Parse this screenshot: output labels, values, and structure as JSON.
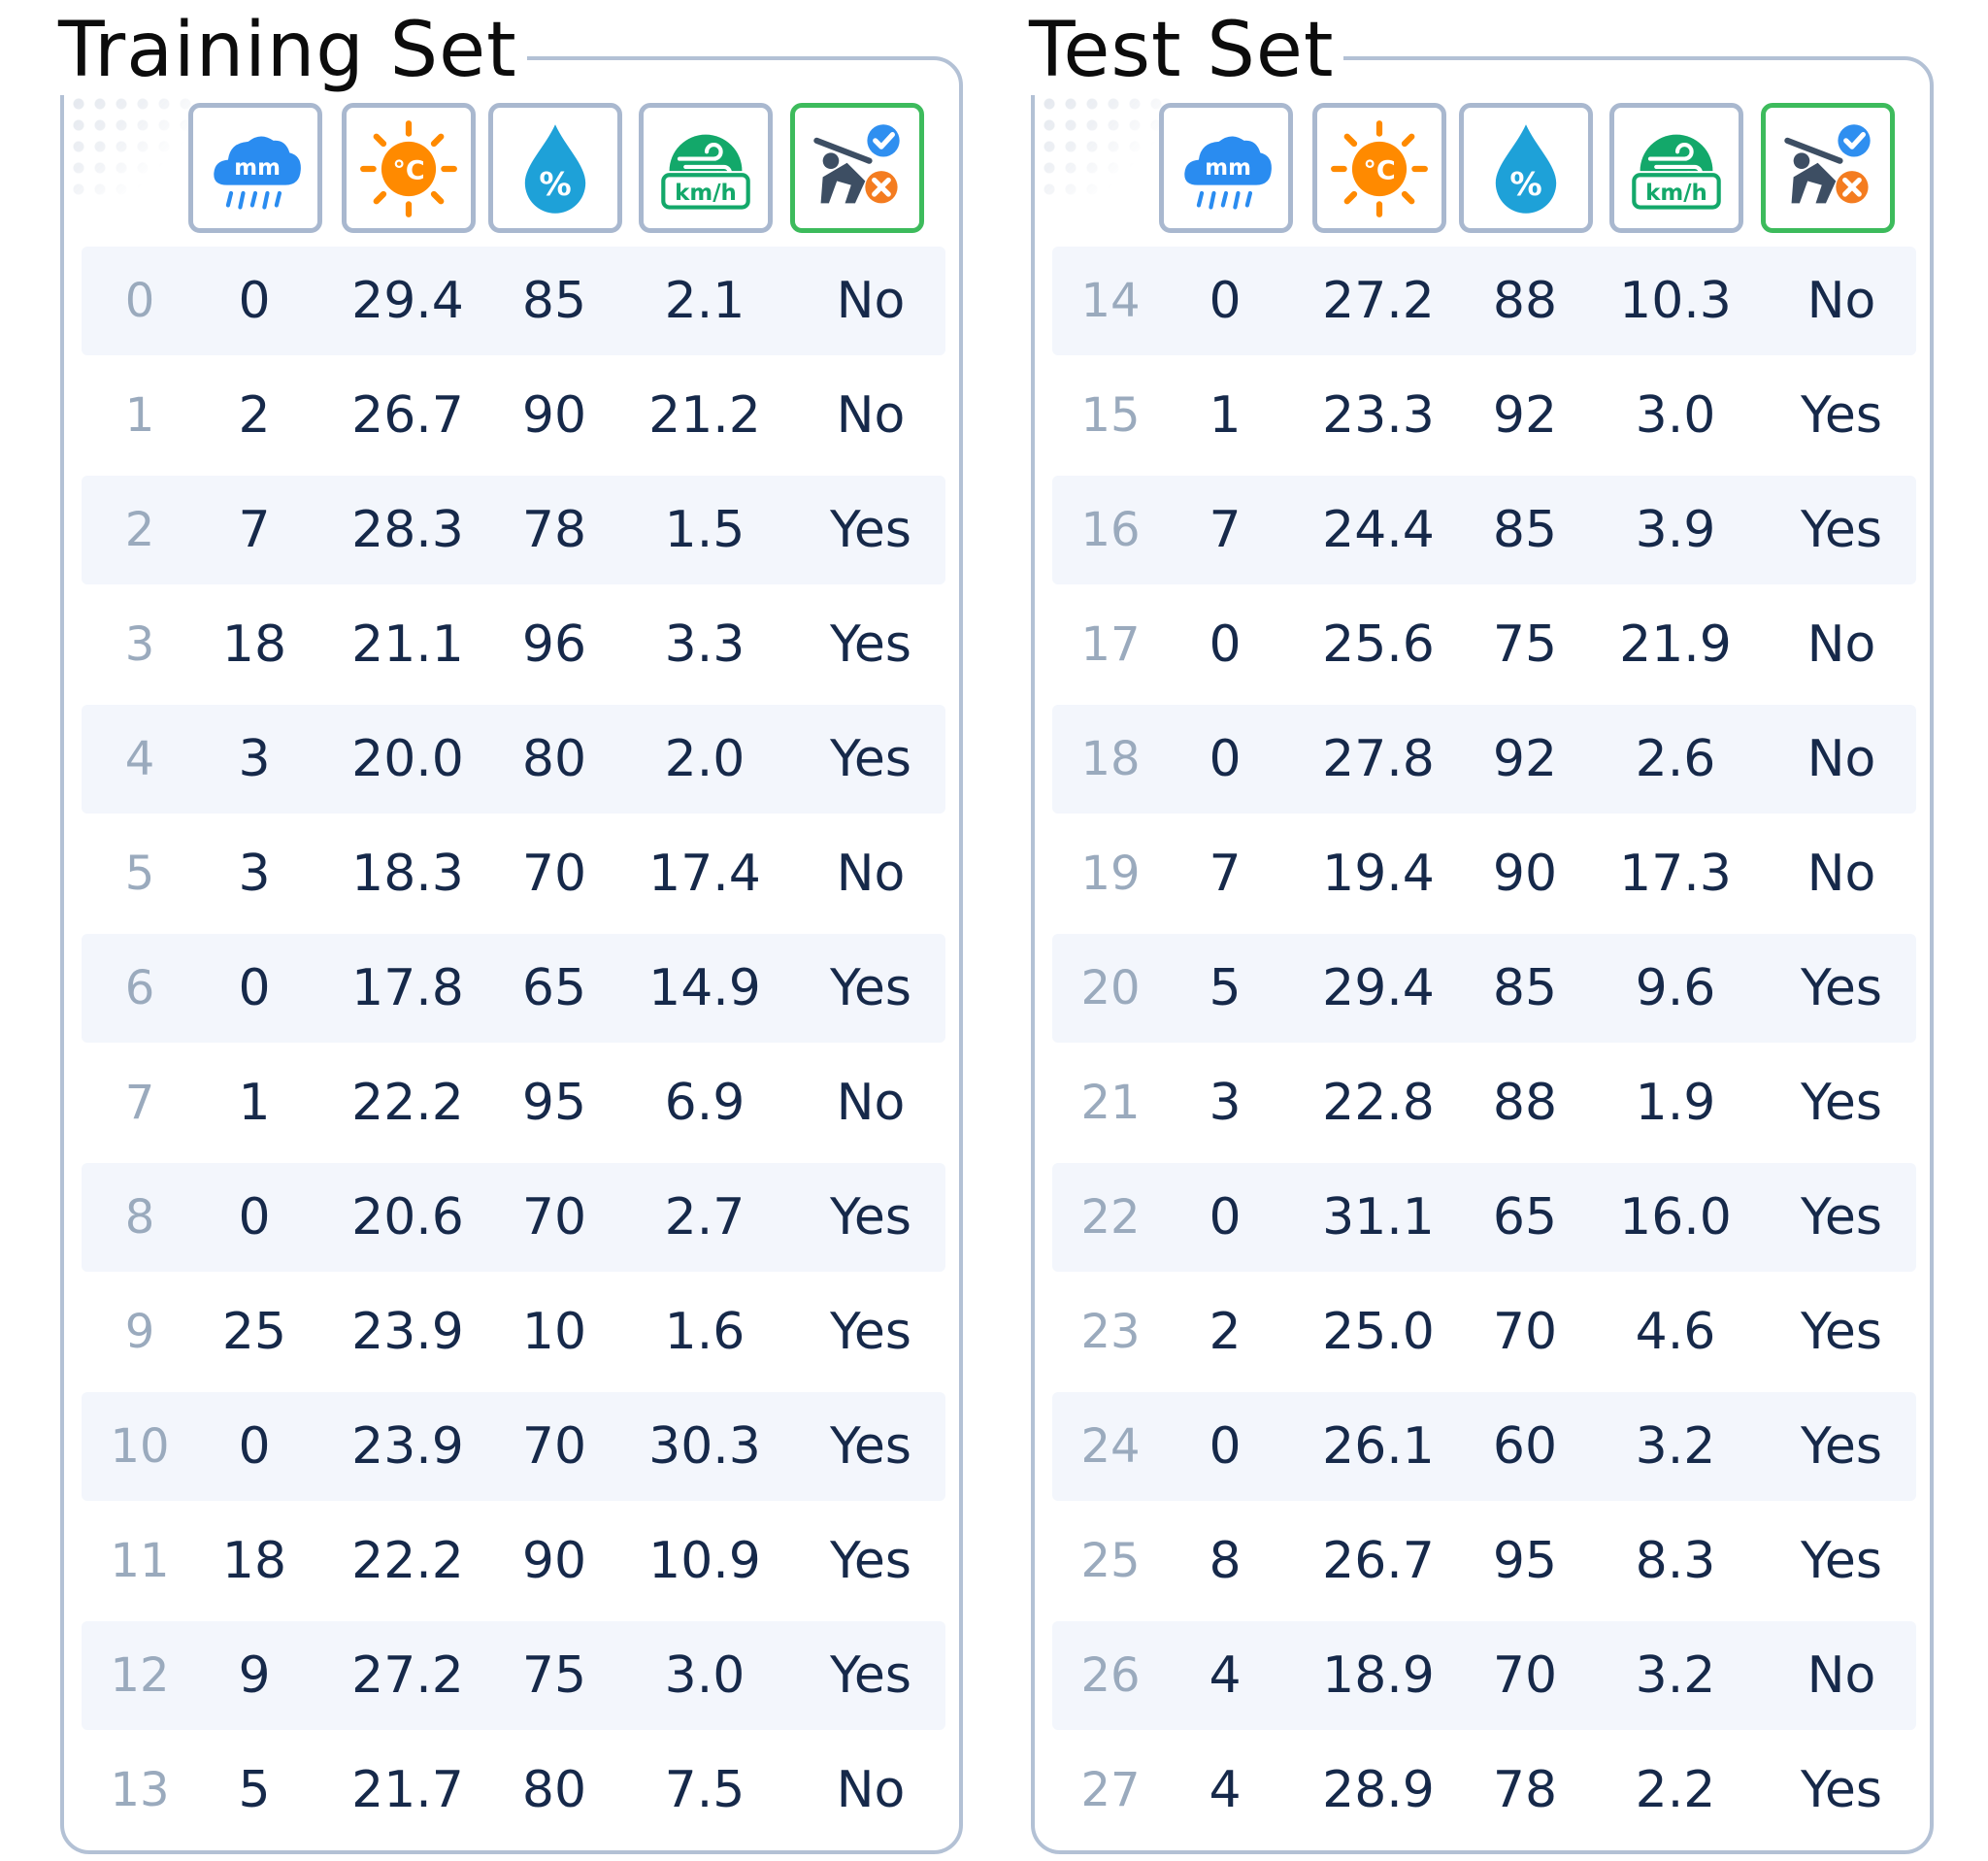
{
  "panels": [
    {
      "title": "Training Set",
      "rows": [
        {
          "index": "0",
          "rain_mm": "0",
          "temp_c": "29.4",
          "humidity_pct": "85",
          "wind_kmh": "2.1",
          "label": "No"
        },
        {
          "index": "1",
          "rain_mm": "2",
          "temp_c": "26.7",
          "humidity_pct": "90",
          "wind_kmh": "21.2",
          "label": "No"
        },
        {
          "index": "2",
          "rain_mm": "7",
          "temp_c": "28.3",
          "humidity_pct": "78",
          "wind_kmh": "1.5",
          "label": "Yes"
        },
        {
          "index": "3",
          "rain_mm": "18",
          "temp_c": "21.1",
          "humidity_pct": "96",
          "wind_kmh": "3.3",
          "label": "Yes"
        },
        {
          "index": "4",
          "rain_mm": "3",
          "temp_c": "20.0",
          "humidity_pct": "80",
          "wind_kmh": "2.0",
          "label": "Yes"
        },
        {
          "index": "5",
          "rain_mm": "3",
          "temp_c": "18.3",
          "humidity_pct": "70",
          "wind_kmh": "17.4",
          "label": "No"
        },
        {
          "index": "6",
          "rain_mm": "0",
          "temp_c": "17.8",
          "humidity_pct": "65",
          "wind_kmh": "14.9",
          "label": "Yes"
        },
        {
          "index": "7",
          "rain_mm": "1",
          "temp_c": "22.2",
          "humidity_pct": "95",
          "wind_kmh": "6.9",
          "label": "No"
        },
        {
          "index": "8",
          "rain_mm": "0",
          "temp_c": "20.6",
          "humidity_pct": "70",
          "wind_kmh": "2.7",
          "label": "Yes"
        },
        {
          "index": "9",
          "rain_mm": "25",
          "temp_c": "23.9",
          "humidity_pct": "10",
          "wind_kmh": "1.6",
          "label": "Yes"
        },
        {
          "index": "10",
          "rain_mm": "0",
          "temp_c": "23.9",
          "humidity_pct": "70",
          "wind_kmh": "30.3",
          "label": "Yes"
        },
        {
          "index": "11",
          "rain_mm": "18",
          "temp_c": "22.2",
          "humidity_pct": "90",
          "wind_kmh": "10.9",
          "label": "Yes"
        },
        {
          "index": "12",
          "rain_mm": "9",
          "temp_c": "27.2",
          "humidity_pct": "75",
          "wind_kmh": "3.0",
          "label": "Yes"
        },
        {
          "index": "13",
          "rain_mm": "5",
          "temp_c": "21.7",
          "humidity_pct": "80",
          "wind_kmh": "7.5",
          "label": "No"
        }
      ]
    },
    {
      "title": "Test Set",
      "rows": [
        {
          "index": "14",
          "rain_mm": "0",
          "temp_c": "27.2",
          "humidity_pct": "88",
          "wind_kmh": "10.3",
          "label": "No"
        },
        {
          "index": "15",
          "rain_mm": "1",
          "temp_c": "23.3",
          "humidity_pct": "92",
          "wind_kmh": "3.0",
          "label": "Yes"
        },
        {
          "index": "16",
          "rain_mm": "7",
          "temp_c": "24.4",
          "humidity_pct": "85",
          "wind_kmh": "3.9",
          "label": "Yes"
        },
        {
          "index": "17",
          "rain_mm": "0",
          "temp_c": "25.6",
          "humidity_pct": "75",
          "wind_kmh": "21.9",
          "label": "No"
        },
        {
          "index": "18",
          "rain_mm": "0",
          "temp_c": "27.8",
          "humidity_pct": "92",
          "wind_kmh": "2.6",
          "label": "No"
        },
        {
          "index": "19",
          "rain_mm": "7",
          "temp_c": "19.4",
          "humidity_pct": "90",
          "wind_kmh": "17.3",
          "label": "No"
        },
        {
          "index": "20",
          "rain_mm": "5",
          "temp_c": "29.4",
          "humidity_pct": "85",
          "wind_kmh": "9.6",
          "label": "Yes"
        },
        {
          "index": "21",
          "rain_mm": "3",
          "temp_c": "22.8",
          "humidity_pct": "88",
          "wind_kmh": "1.9",
          "label": "Yes"
        },
        {
          "index": "22",
          "rain_mm": "0",
          "temp_c": "31.1",
          "humidity_pct": "65",
          "wind_kmh": "16.0",
          "label": "Yes"
        },
        {
          "index": "23",
          "rain_mm": "2",
          "temp_c": "25.0",
          "humidity_pct": "70",
          "wind_kmh": "4.6",
          "label": "Yes"
        },
        {
          "index": "24",
          "rain_mm": "0",
          "temp_c": "26.1",
          "humidity_pct": "60",
          "wind_kmh": "3.2",
          "label": "Yes"
        },
        {
          "index": "25",
          "rain_mm": "8",
          "temp_c": "26.7",
          "humidity_pct": "95",
          "wind_kmh": "8.3",
          "label": "Yes"
        },
        {
          "index": "26",
          "rain_mm": "4",
          "temp_c": "18.9",
          "humidity_pct": "70",
          "wind_kmh": "3.2",
          "label": "No"
        },
        {
          "index": "27",
          "rain_mm": "4",
          "temp_c": "28.9",
          "humidity_pct": "78",
          "wind_kmh": "2.2",
          "label": "Yes"
        }
      ]
    }
  ],
  "icons": {
    "rain": {
      "name": "rain-mm-icon",
      "text": "mm",
      "color": "#2a8cf0"
    },
    "temperature": {
      "name": "temperature-celsius-icon",
      "text": "°C",
      "color": "#ff8a00"
    },
    "humidity": {
      "name": "humidity-percent-icon",
      "text": "%",
      "color": "#1ea1d8"
    },
    "wind": {
      "name": "wind-speed-icon",
      "text": "km/h",
      "color": "#13a86a"
    },
    "target": {
      "name": "golf-yes-no-icon",
      "yes_color": "#2f8ff0",
      "no_color": "#f47c20"
    }
  },
  "colors": {
    "panel_border": "#b3c1d5",
    "tile_border": "#a9b8cf",
    "target_tile_border": "#3dbb5c",
    "row_shade": "#f3f6fc",
    "text": "#16294a",
    "index_text": "#9aaabd"
  }
}
